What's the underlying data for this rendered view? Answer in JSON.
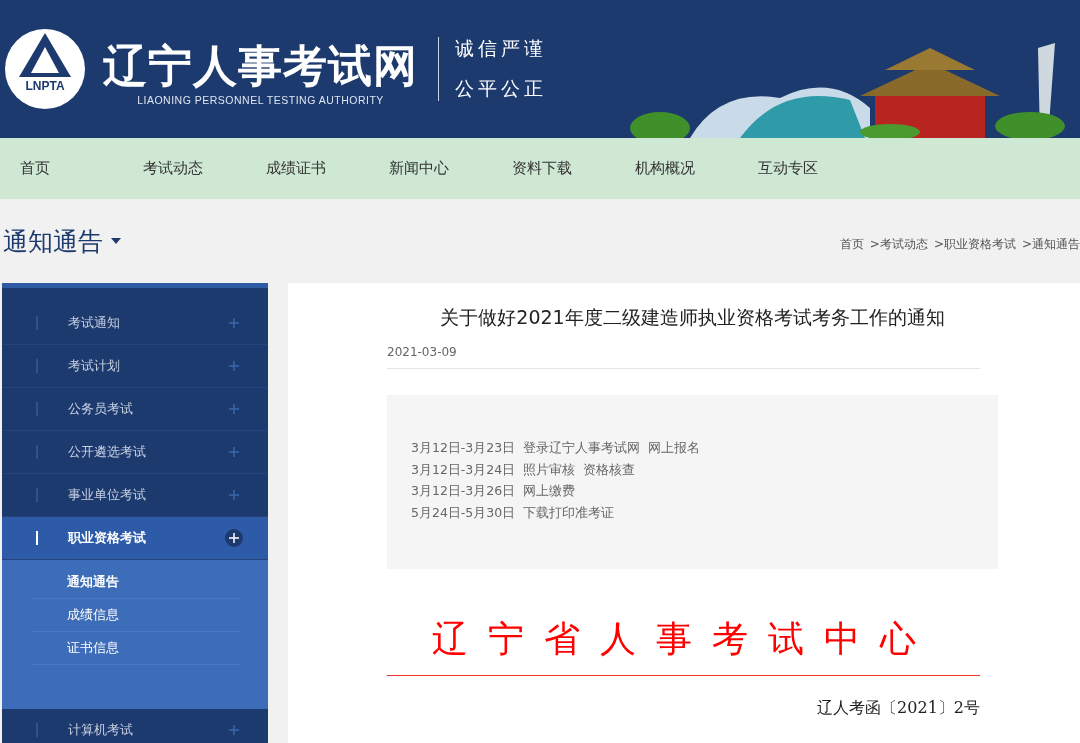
{
  "header": {
    "logo_text": "LNPTA",
    "site_title": "辽宁人事考试网",
    "site_subtitle": "LIAONING PERSONNEL TESTING AUTHORITY",
    "mottos": [
      "诚信严谨",
      "公平公正"
    ]
  },
  "nav": {
    "items": [
      "首页",
      "考试动态",
      "成绩证书",
      "新闻中心",
      "资料下载",
      "机构概况",
      "互动专区"
    ]
  },
  "page_title": "通知通告",
  "breadcrumb": [
    "首页",
    ">考试动态",
    ">职业资格考试",
    ">通知通告"
  ],
  "sidebar": {
    "items": [
      {
        "label": "考试通知",
        "selected": false,
        "expanded": false
      },
      {
        "label": "考试计划",
        "selected": false,
        "expanded": false
      },
      {
        "label": "公务员考试",
        "selected": false,
        "expanded": false
      },
      {
        "label": "公开遴选考试",
        "selected": false,
        "expanded": false
      },
      {
        "label": "事业单位考试",
        "selected": false,
        "expanded": false
      },
      {
        "label": "职业资格考试",
        "selected": true,
        "expanded": true,
        "children": [
          {
            "label": "通知通告",
            "selected": true
          },
          {
            "label": "成绩信息",
            "selected": false
          },
          {
            "label": "证书信息",
            "selected": false
          }
        ]
      },
      {
        "label": "计算机考试",
        "selected": false,
        "expanded": false
      }
    ]
  },
  "article": {
    "title": "关于做好2021年度二级建造师执业资格考试考务工作的通知",
    "date": "2021-03-09",
    "schedule": [
      "3月12日-3月23日  登录辽宁人事考试网  网上报名",
      "3月12日-3月24日  照片审核  资格核查",
      "3月12日-3月26日  网上缴费",
      "5月24日-5月30日  下载打印准考证"
    ],
    "issuer": "辽宁省人事考试中心",
    "doc_number": "辽人考函〔2021〕2号"
  }
}
